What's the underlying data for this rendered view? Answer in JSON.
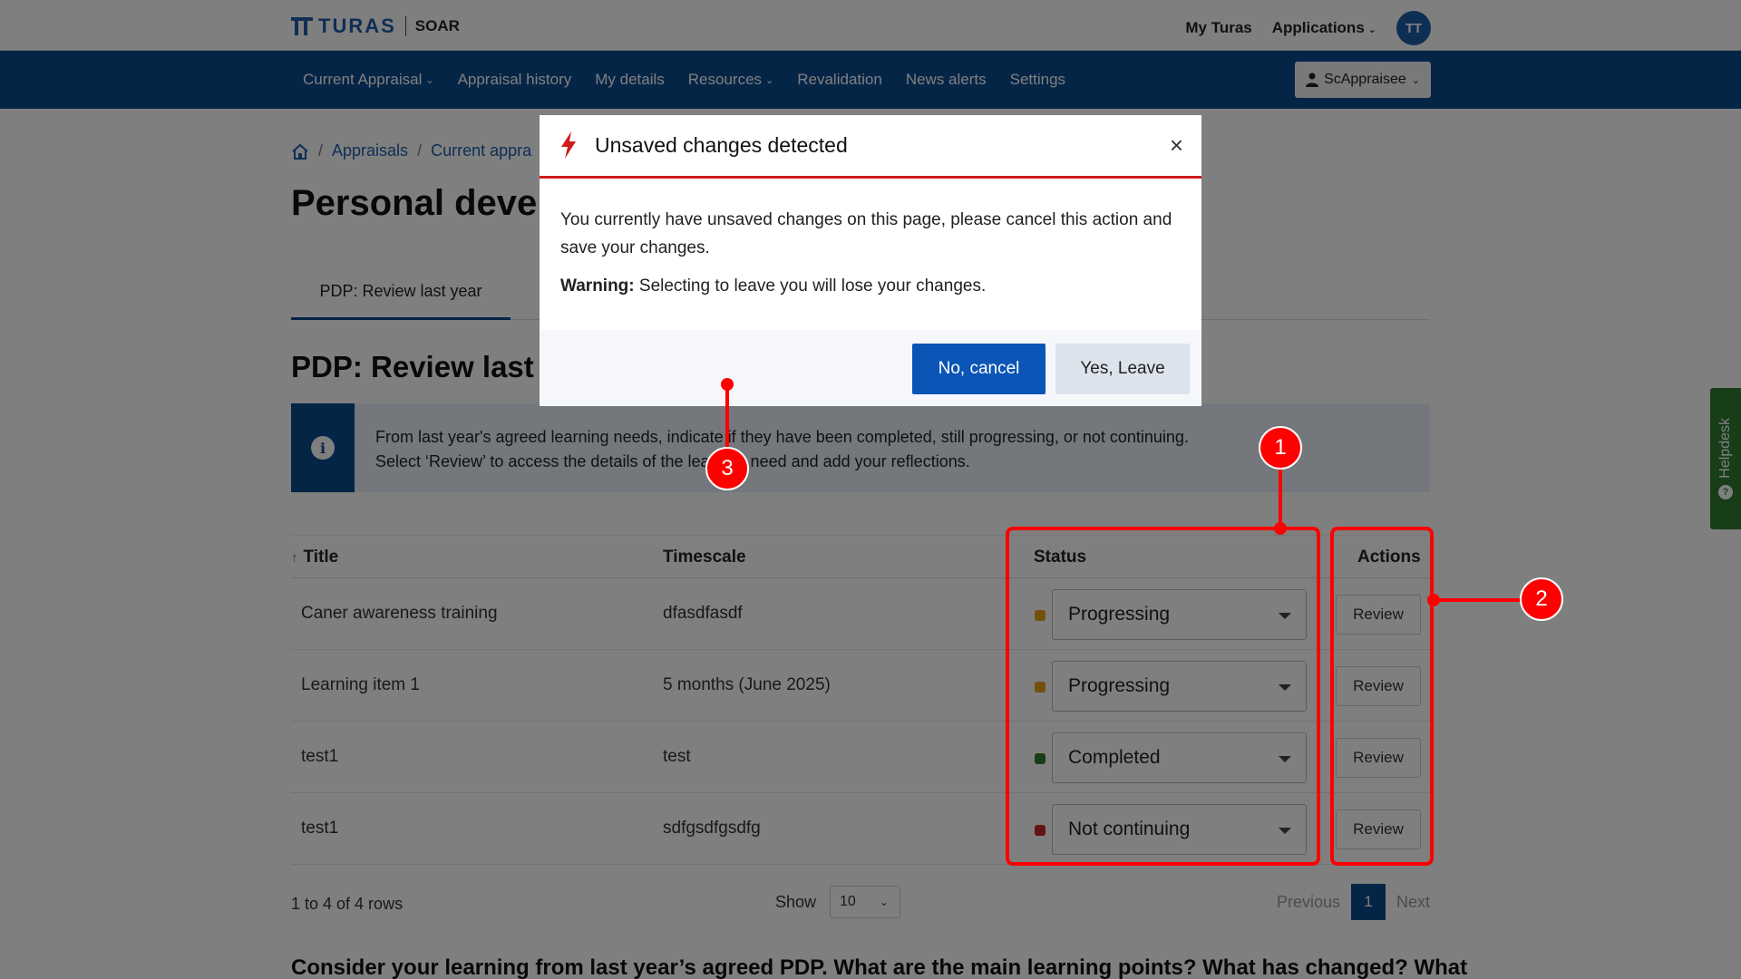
{
  "header": {
    "brand": "TURAS",
    "app_name": "SOAR",
    "my_turas": "My Turas",
    "applications": "Applications",
    "avatar_initials": "TT"
  },
  "nav": {
    "items": [
      {
        "label": "Current Appraisal",
        "dropdown": true
      },
      {
        "label": "Appraisal history",
        "dropdown": false
      },
      {
        "label": "My details",
        "dropdown": false
      },
      {
        "label": "Resources",
        "dropdown": true
      },
      {
        "label": "Revalidation",
        "dropdown": false
      },
      {
        "label": "News alerts",
        "dropdown": false
      },
      {
        "label": "Settings",
        "dropdown": false
      }
    ],
    "user": "ScAppraisee"
  },
  "breadcrumb": {
    "items": [
      "Appraisals",
      "Current appra"
    ]
  },
  "page": {
    "title": "Personal devel",
    "active_tab": "PDP: Review last year",
    "section_title": "PDP: Review last y",
    "info_line1": "From last year's agreed learning needs, indicate if they have been completed, still progressing, or not continuing.",
    "info_line2": "Select ‘Review’ to access the details of the learning need and add your reflections.",
    "question": "Consider your learning from last year’s agreed PDP. What are the main learning points? What has changed? What"
  },
  "table": {
    "headers": {
      "title": "Title",
      "timescale": "Timescale",
      "status": "Status",
      "actions": "Actions"
    },
    "rows": [
      {
        "title": "Caner awareness training",
        "timescale": "dfasdfasdf",
        "status": "Progressing",
        "status_color": "#e6a116",
        "action": "Review"
      },
      {
        "title": "Learning item 1",
        "timescale": "5 months (June 2025)",
        "status": "Progressing",
        "status_color": "#e6a116",
        "action": "Review"
      },
      {
        "title": "test1",
        "timescale": "test",
        "status": "Completed",
        "status_color": "#2e7d32",
        "action": "Review"
      },
      {
        "title": "test1",
        "timescale": "sdfgsdfgsdfg",
        "status": "Not continuing",
        "status_color": "#c62828",
        "action": "Review"
      }
    ],
    "footer": {
      "rows_count": "1 to 4 of 4 rows",
      "show_label": "Show",
      "page_size": "10",
      "previous": "Previous",
      "current_page": "1",
      "next": "Next"
    }
  },
  "helpdesk": {
    "label": "Helpdesk"
  },
  "modal": {
    "title": "Unsaved changes detected",
    "close": "×",
    "body": "You currently have unsaved changes on this page, please cancel this action and save your changes.",
    "warning_label": "Warning:",
    "warning_text": " Selecting to leave you will lose your changes.",
    "cancel_label": "No, cancel",
    "leave_label": "Yes, Leave"
  },
  "annotations": {
    "labels": [
      "1",
      "2",
      "3"
    ],
    "color": "#ff0000"
  },
  "colors": {
    "nav_bg": "#0a4a8f",
    "primary_button": "#0a55b5",
    "modal_accent": "#d01c1c",
    "helpdesk": "#2e7d32"
  }
}
